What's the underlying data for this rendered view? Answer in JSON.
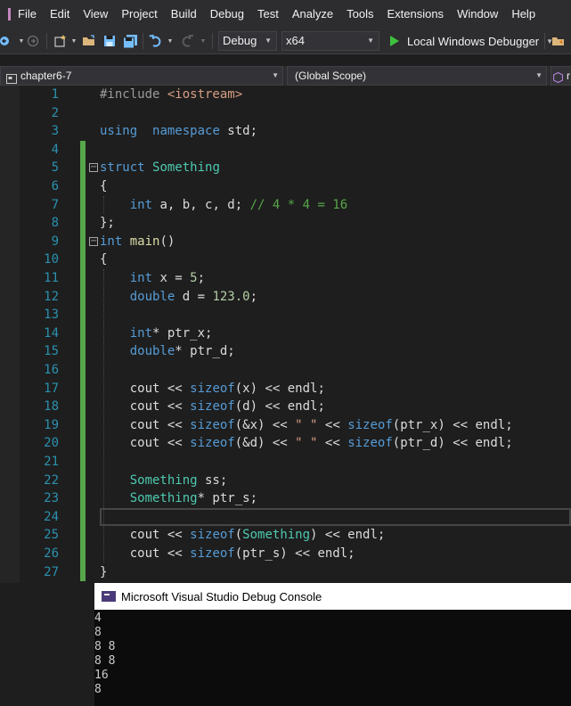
{
  "menu": [
    "File",
    "Edit",
    "View",
    "Project",
    "Build",
    "Debug",
    "Test",
    "Analyze",
    "Tools",
    "Extensions",
    "Window",
    "Help"
  ],
  "toolbar": {
    "configuration": "Debug",
    "platform": "x64",
    "run_label": "Local Windows Debugger"
  },
  "navbar": {
    "project": "chapter6-7",
    "scope": "(Global Scope)",
    "member_partial": "r"
  },
  "editor": {
    "line_numbers": [
      "1",
      "2",
      "3",
      "4",
      "5",
      "6",
      "7",
      "8",
      "9",
      "10",
      "11",
      "12",
      "13",
      "14",
      "15",
      "16",
      "17",
      "18",
      "19",
      "20",
      "21",
      "22",
      "23",
      "24",
      "25",
      "26",
      "27"
    ],
    "current_line": 24,
    "lines": [
      [
        [
          "pp",
          "#include "
        ],
        [
          "st",
          "<iostream>"
        ]
      ],
      [],
      [
        [
          "kw",
          "using"
        ],
        [
          "",
          "  "
        ],
        [
          "kw",
          "namespace"
        ],
        [
          "",
          " std;"
        ]
      ],
      [],
      [
        [
          "kw",
          "struct"
        ],
        [
          "",
          " "
        ],
        [
          "ty",
          "Something"
        ]
      ],
      [
        [
          "",
          "{"
        ]
      ],
      [
        [
          "",
          "    "
        ],
        [
          "kw",
          "int"
        ],
        [
          "",
          " a, b, c, d; "
        ],
        [
          "cm",
          "// 4 * 4 = 16"
        ]
      ],
      [
        [
          "",
          "};"
        ]
      ],
      [
        [
          "kw",
          "int"
        ],
        [
          "",
          " "
        ],
        [
          "fn",
          "main"
        ],
        [
          "",
          "()"
        ]
      ],
      [
        [
          "",
          "{"
        ]
      ],
      [
        [
          "",
          "    "
        ],
        [
          "kw",
          "int"
        ],
        [
          "",
          " x = "
        ],
        [
          "nm",
          "5"
        ],
        [
          "",
          ";"
        ]
      ],
      [
        [
          "",
          "    "
        ],
        [
          "kw",
          "double"
        ],
        [
          "",
          " d = "
        ],
        [
          "nm",
          "123.0"
        ],
        [
          "",
          ";"
        ]
      ],
      [],
      [
        [
          "",
          "    "
        ],
        [
          "kw",
          "int"
        ],
        [
          "",
          "* ptr_x;"
        ]
      ],
      [
        [
          "",
          "    "
        ],
        [
          "kw",
          "double"
        ],
        [
          "",
          "* ptr_d;"
        ]
      ],
      [],
      [
        [
          "",
          "    cout << "
        ],
        [
          "kw",
          "sizeof"
        ],
        [
          "",
          "(x) << endl;"
        ]
      ],
      [
        [
          "",
          "    cout << "
        ],
        [
          "kw",
          "sizeof"
        ],
        [
          "",
          "(d) << endl;"
        ]
      ],
      [
        [
          "",
          "    cout << "
        ],
        [
          "kw",
          "sizeof"
        ],
        [
          "",
          "(&x) << "
        ],
        [
          "st",
          "\" \""
        ],
        [
          "",
          " << "
        ],
        [
          "kw",
          "sizeof"
        ],
        [
          "",
          "(ptr_x) << endl;"
        ]
      ],
      [
        [
          "",
          "    cout << "
        ],
        [
          "kw",
          "sizeof"
        ],
        [
          "",
          "(&d) << "
        ],
        [
          "st",
          "\" \""
        ],
        [
          "",
          " << "
        ],
        [
          "kw",
          "sizeof"
        ],
        [
          "",
          "(ptr_d) << endl;"
        ]
      ],
      [],
      [
        [
          "",
          "    "
        ],
        [
          "ty",
          "Something"
        ],
        [
          "",
          " ss;"
        ]
      ],
      [
        [
          "",
          "    "
        ],
        [
          "ty",
          "Something"
        ],
        [
          "",
          "* ptr_s;"
        ]
      ],
      [],
      [
        [
          "",
          "    cout << "
        ],
        [
          "kw",
          "sizeof"
        ],
        [
          "",
          "("
        ],
        [
          "ty",
          "Something"
        ],
        [
          "",
          ") << endl;"
        ]
      ],
      [
        [
          "",
          "    cout << "
        ],
        [
          "kw",
          "sizeof"
        ],
        [
          "",
          "(ptr_s) << endl;"
        ]
      ],
      [
        [
          "",
          "}"
        ]
      ]
    ],
    "fold_markers": [
      5,
      9
    ]
  },
  "console": {
    "title": "Microsoft Visual Studio Debug Console",
    "output": [
      "4",
      "8",
      "8 8",
      "8 8",
      "16",
      "8"
    ]
  },
  "colors": {
    "keyword": "#569cd6",
    "type": "#4ec9b0",
    "function": "#dcdcaa",
    "number": "#b5cea8",
    "comment": "#57a64a",
    "string": "#d69d85",
    "line_number": "#2b91af"
  }
}
